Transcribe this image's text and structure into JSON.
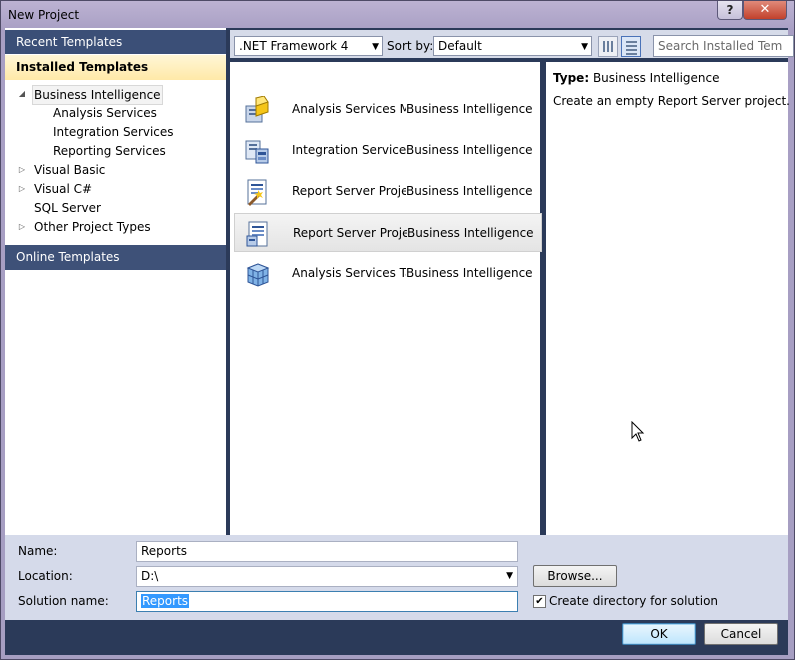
{
  "window": {
    "title": "New Project",
    "help_label": "?",
    "close_label": "✕"
  },
  "left_nav": {
    "recent_templates": "Recent Templates",
    "installed_templates": "Installed Templates",
    "online_templates": "Online Templates",
    "tree": [
      {
        "label": "Business Intelligence",
        "expanded": true,
        "selected": true
      },
      {
        "label": "Analysis Services"
      },
      {
        "label": "Integration Services"
      },
      {
        "label": "Reporting Services"
      },
      {
        "label": "Visual Basic",
        "expandable": true
      },
      {
        "label": "Visual C#",
        "expandable": true
      },
      {
        "label": "SQL Server"
      },
      {
        "label": "Other Project Types",
        "expandable": true
      }
    ]
  },
  "toolbar": {
    "framework": ".NET Framework 4",
    "sort_by_label": "Sort by:",
    "sort_by_value": "Default",
    "search_placeholder": "Search Installed Tem"
  },
  "templates": [
    {
      "name": "Analysis Services M...",
      "category": "Business Intelligence",
      "icon": "analysis-services-icon"
    },
    {
      "name": "Integration Services...",
      "category": "Business Intelligence",
      "icon": "integration-services-icon"
    },
    {
      "name": "Report Server Proje...",
      "category": "Business Intelligence",
      "icon": "report-wizard-icon"
    },
    {
      "name": "Report Server Project",
      "category": "Business Intelligence",
      "icon": "report-server-icon",
      "selected": true
    },
    {
      "name": "Analysis Services Ta...",
      "category": "Business Intelligence",
      "icon": "tabular-cube-icon"
    }
  ],
  "details": {
    "type_label": "Type:",
    "type_value": "Business Intelligence",
    "description": "Create an empty Report Server project."
  },
  "form": {
    "name_label": "Name:",
    "name_value": "Reports",
    "location_label": "Location:",
    "location_value": "D:\\",
    "solution_label": "Solution name:",
    "solution_value": "Reports",
    "browse_label": "Browse...",
    "create_dir_label": "Create directory for solution",
    "create_dir_checked": true
  },
  "buttons": {
    "ok": "OK",
    "cancel": "Cancel"
  }
}
